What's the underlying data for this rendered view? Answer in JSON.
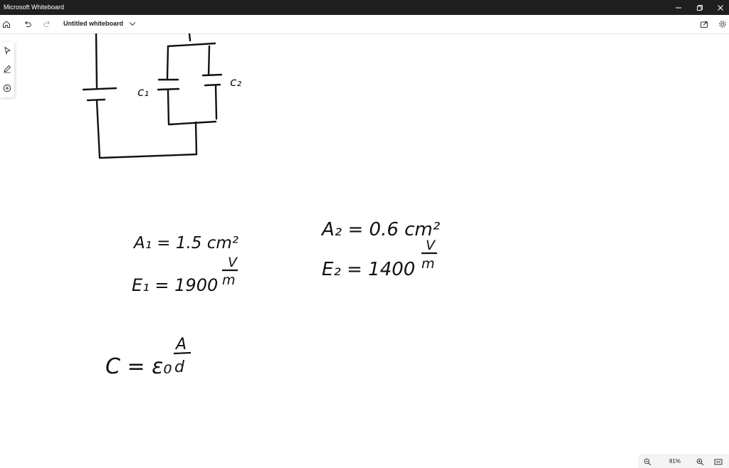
{
  "window": {
    "app_title": "Microsoft Whiteboard",
    "minimize_icon": "minimize-icon",
    "restore_icon": "restore-icon",
    "close_icon": "close-icon"
  },
  "toolbar": {
    "home_icon": "home-icon",
    "undo_icon": "undo-icon",
    "redo_icon": "redo-icon",
    "document_title": "Untitled whiteboard",
    "chevron_icon": "chevron-down-icon",
    "share_icon": "share-icon",
    "settings_icon": "gear-icon"
  },
  "side_rail": {
    "tools": [
      {
        "name": "select-tool",
        "icon": "pointer-icon"
      },
      {
        "name": "pen-tool",
        "icon": "pen-icon"
      },
      {
        "name": "add-tool",
        "icon": "plus-circle-icon"
      }
    ]
  },
  "whiteboard": {
    "c1_label": "c₁",
    "c2_label": "c₂",
    "a1_expr": "A₁ = 1.5 cm²",
    "a2_expr": "A₂ = 0.6 cm²",
    "e1_lhs": "E₁ = 1900",
    "e2_lhs": "E₂ = 1400",
    "unit_num": "V",
    "unit_den": "m",
    "formula_lhs": "C = ε₀",
    "formula_num": "A",
    "formula_den": "d"
  },
  "zoombar": {
    "zoom_out_icon": "zoom-out-icon",
    "zoom_level": "81%",
    "zoom_in_icon": "zoom-in-icon",
    "fit_icon": "fit-to-screen-icon"
  }
}
